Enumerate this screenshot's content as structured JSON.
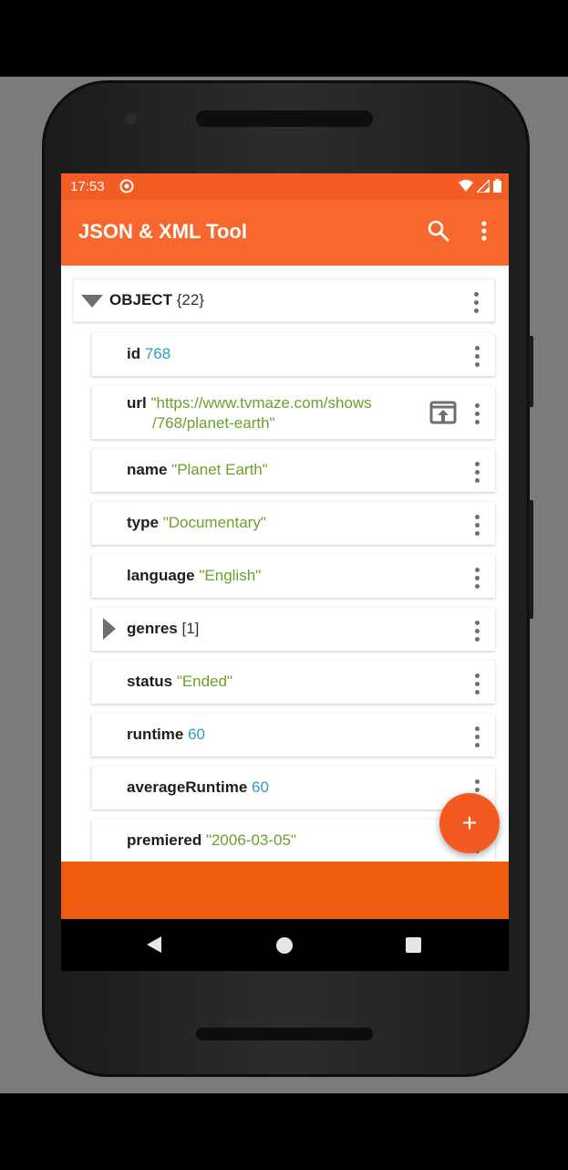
{
  "status_bar": {
    "time": "17:53"
  },
  "app_bar": {
    "title": "JSON & XML Tool"
  },
  "root": {
    "label": "OBJECT",
    "count": "{22}"
  },
  "rows": [
    {
      "key": "id",
      "value": "768",
      "kind": "number"
    },
    {
      "key": "url",
      "value": "\"https://www.tvmaze.com/shows/768/planet-earth\"",
      "kind": "string",
      "line1": "\"https://www.tvmaze.com/shows",
      "line2": "/768/planet-earth\""
    },
    {
      "key": "name",
      "value": "\"Planet Earth\"",
      "kind": "string"
    },
    {
      "key": "type",
      "value": "\"Documentary\"",
      "kind": "string"
    },
    {
      "key": "language",
      "value": "\"English\"",
      "kind": "string"
    },
    {
      "key": "genres",
      "value": "[1]",
      "kind": "array"
    },
    {
      "key": "status",
      "value": "\"Ended\"",
      "kind": "string"
    },
    {
      "key": "runtime",
      "value": "60",
      "kind": "number"
    },
    {
      "key": "averageRuntime",
      "value": "60",
      "kind": "number"
    },
    {
      "key": "premiered",
      "value": "\"2006-03-05\"",
      "kind": "string"
    }
  ],
  "fab": {
    "label": "+"
  },
  "colors": {
    "accent": "#f7672e",
    "status_bar": "#f35d23",
    "banner": "#ee5c0f",
    "number": "#2c9bc4",
    "string": "#6ba02b"
  },
  "icons": [
    "notification-icon",
    "wifi-icon",
    "signal-icon",
    "battery-icon",
    "search-icon",
    "more-vert-icon",
    "open-in-browser-icon",
    "back-icon",
    "home-icon",
    "recents-icon"
  ]
}
